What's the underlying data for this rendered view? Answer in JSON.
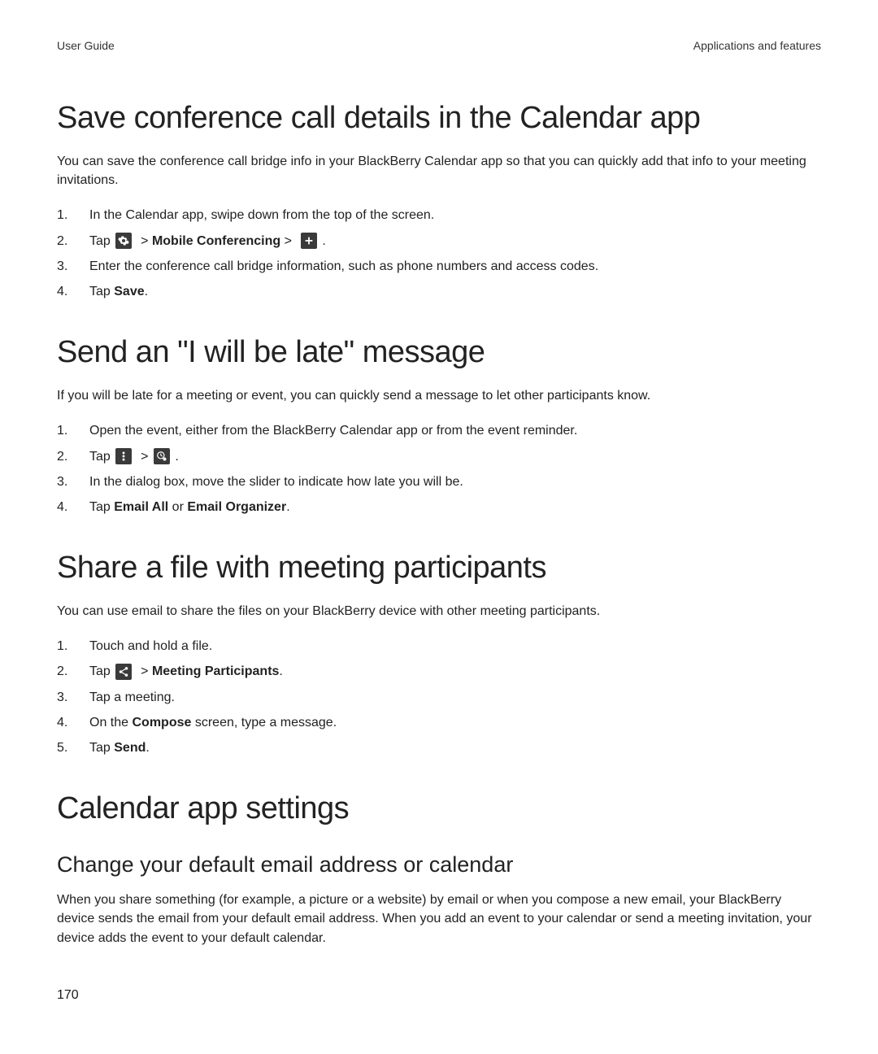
{
  "header": {
    "left": "User Guide",
    "right": "Applications and features"
  },
  "section1": {
    "title": "Save conference call details in the Calendar app",
    "intro": "You can save the conference call bridge info in your BlackBerry Calendar app so that you can quickly add that info to your meeting invitations.",
    "steps": {
      "s1": "In the Calendar app, swipe down from the top of the screen.",
      "s2_tap": "Tap",
      "s2_bold": "Mobile Conferencing",
      "s3": "Enter the conference call bridge information, such as phone numbers and access codes.",
      "s4": "Tap ",
      "s4_bold": "Save",
      "s4_period": "."
    }
  },
  "section2": {
    "title": "Send an \"I will be late\" message",
    "intro": "If you will be late for a meeting or event, you can quickly send a message to let other participants know.",
    "steps": {
      "s1": "Open the event, either from the BlackBerry Calendar app or from the event reminder.",
      "s2_tap": "Tap",
      "s3": "In the dialog box, move the slider to indicate how late you will be.",
      "s4": "Tap ",
      "s4_bold1": "Email All",
      "s4_or": " or ",
      "s4_bold2": "Email Organizer",
      "s4_period": "."
    }
  },
  "section3": {
    "title": "Share a file with meeting participants",
    "intro": "You can use email to share the files on your BlackBerry device with other meeting participants.",
    "steps": {
      "s1": "Touch and hold a file.",
      "s2_tap": "Tap",
      "s2_bold": "Meeting Participants",
      "s3": "Tap a meeting.",
      "s4_a": "On the ",
      "s4_bold": "Compose",
      "s4_b": " screen, type a message.",
      "s5": "Tap ",
      "s5_bold": "Send",
      "s5_period": "."
    }
  },
  "section4": {
    "title": "Calendar app settings",
    "sub": {
      "title": "Change your default email address or calendar",
      "body": "When you share something (for example, a picture or a website) by email or when you compose a new email, your BlackBerry device sends the email from your default email address. When you add an event to your calendar or send a meeting invitation, your device adds the event to your default calendar."
    }
  },
  "page_number": "170",
  "gt": ">",
  "period": "."
}
